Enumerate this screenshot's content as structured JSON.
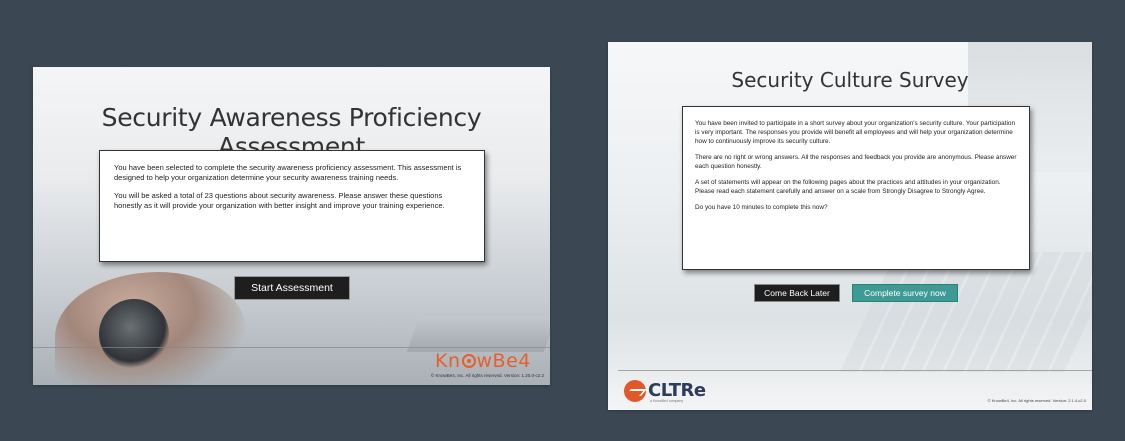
{
  "left_screen": {
    "title": "Security Awareness Proficiency Assessment",
    "paragraphs": [
      "You have been selected to complete the security awareness proficiency assessment. This assessment is designed to help your organization determine your security awareness training needs.",
      "You will be asked a total of 23 questions about security awareness. Please answer these questions honestly as it will provide your organization with better insight and improve your training experience."
    ],
    "start_button": "Start Assessment",
    "logo": {
      "prefix": "Kn",
      "suffix": "wBe4"
    },
    "footer": "© KnowBe4, Inc. All rights reserved. Version: 1.20.0-c2.2"
  },
  "right_screen": {
    "title": "Security Culture Survey",
    "paragraphs": [
      "You have been invited to participate in a short survey about your organization's security culture. Your participation is very important. The responses you provide will benefit all employees and will help your organization determine how to continuously improve its security culture.",
      "There are no right or wrong answers. All the responses and feedback you provide are anonymous. Please answer each question honestly.",
      "A set of statements will appear on the following pages about the practices and attitudes in your organization. Please read each statement carefully and answer on a scale from Strongly Disagree to Strongly Agree.",
      "Do you have 10 minutes to complete this now?"
    ],
    "come_back_button": "Come Back Later",
    "complete_button": "Complete survey now",
    "logo_text": "CLTRe",
    "logo_subtext": "a KnowBe4 company",
    "footer": "© KnowBe4, Inc. All rights reserved. Version: 2.1.4-c2.0"
  },
  "colors": {
    "background": "#3b4853",
    "knowbe4_orange": "#e65f2b",
    "complete_button_teal": "#3e9a94",
    "cltre_navy": "#2d3b5c"
  }
}
